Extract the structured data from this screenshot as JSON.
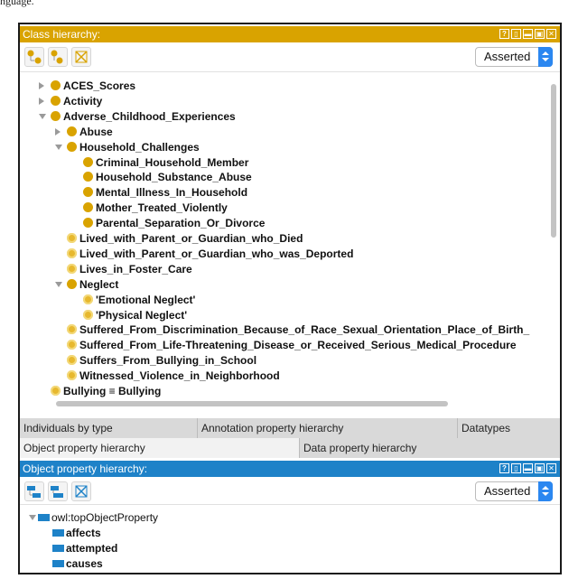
{
  "caption": "nguage.",
  "class_panel": {
    "title": "Class hierarchy:",
    "asserted": "Asserted",
    "tree": [
      {
        "label": "ACES_Scores",
        "depth": 0,
        "toggle": "collapsed",
        "dot": "solid"
      },
      {
        "label": "Activity",
        "depth": 0,
        "toggle": "collapsed",
        "dot": "solid"
      },
      {
        "label": "Adverse_Childhood_Experiences",
        "depth": 0,
        "toggle": "expanded",
        "dot": "solid"
      },
      {
        "label": "Abuse",
        "depth": 1,
        "toggle": "collapsed",
        "dot": "solid"
      },
      {
        "label": "Household_Challenges",
        "depth": 1,
        "toggle": "expanded",
        "dot": "solid"
      },
      {
        "label": "Criminal_Household_Member",
        "depth": 2,
        "toggle": "none",
        "dot": "solid"
      },
      {
        "label": "Household_Substance_Abuse",
        "depth": 2,
        "toggle": "none",
        "dot": "solid"
      },
      {
        "label": "Mental_Illness_In_Household",
        "depth": 2,
        "toggle": "none",
        "dot": "solid"
      },
      {
        "label": "Mother_Treated_Violently",
        "depth": 2,
        "toggle": "none",
        "dot": "solid"
      },
      {
        "label": "Parental_Separation_Or_Divorce",
        "depth": 2,
        "toggle": "none",
        "dot": "solid"
      },
      {
        "label": "Lived_with_Parent_or_Guardian_who_Died",
        "depth": 1,
        "toggle": "none",
        "dot": "light"
      },
      {
        "label": "Lived_with_Parent_or_Guardian_who_was_Deported",
        "depth": 1,
        "toggle": "none",
        "dot": "light"
      },
      {
        "label": "Lives_in_Foster_Care",
        "depth": 1,
        "toggle": "none",
        "dot": "light"
      },
      {
        "label": "Neglect",
        "depth": 1,
        "toggle": "expanded",
        "dot": "solid"
      },
      {
        "label": "'Emotional Neglect'",
        "depth": 2,
        "toggle": "none",
        "dot": "light"
      },
      {
        "label": "'Physical Neglect'",
        "depth": 2,
        "toggle": "none",
        "dot": "light"
      },
      {
        "label": "Suffered_From_Discrimination_Because_of_Race_Sexual_Orientation_Place_of_Birth_",
        "depth": 1,
        "toggle": "none",
        "dot": "light"
      },
      {
        "label": "Suffered_From_Life-Threatening_Disease_or_Received_Serious_Medical_Procedure",
        "depth": 1,
        "toggle": "none",
        "dot": "light"
      },
      {
        "label": "Suffers_From_Bullying_in_School",
        "depth": 1,
        "toggle": "none",
        "dot": "light"
      },
      {
        "label": "Witnessed_Violence_in_Neighborhood",
        "depth": 1,
        "toggle": "none",
        "dot": "light"
      },
      {
        "label": "Bullying ≡ Bullying",
        "depth": 0,
        "toggle": "none",
        "dot": "light"
      }
    ]
  },
  "tabs_row1": [
    "Individuals by type",
    "Annotation property hierarchy",
    "Datatypes"
  ],
  "tabs_row2": [
    "Object property hierarchy",
    "Data property hierarchy"
  ],
  "objprop_panel": {
    "title": "Object property hierarchy:",
    "asserted": "Asserted",
    "root": "owl:topObjectProperty",
    "children": [
      "affects",
      "attempted",
      "causes"
    ]
  },
  "colors": {
    "class_accent": "#d9a300",
    "objprop_accent": "#1e82c8",
    "select_arrow": "#2b87f0"
  }
}
